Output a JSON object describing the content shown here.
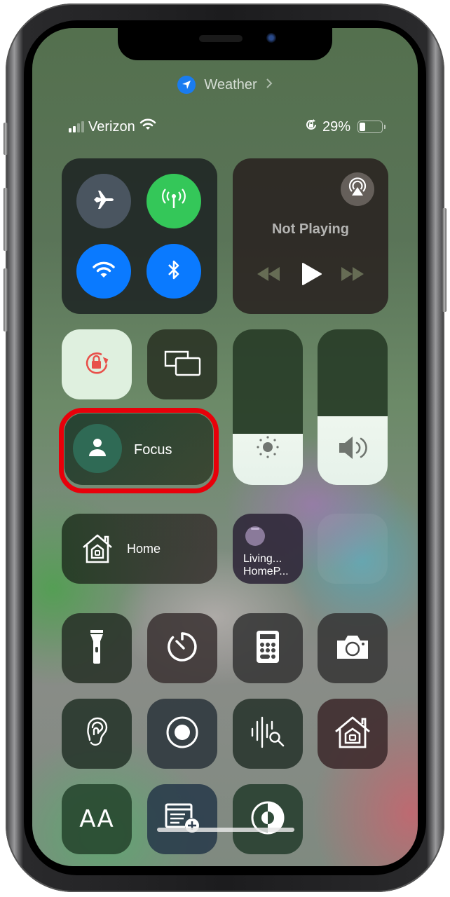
{
  "location_banner": {
    "icon": "location-arrow-icon",
    "app": "Weather",
    "chevron": "chevron-right-icon"
  },
  "status_bar": {
    "carrier": "Verizon",
    "signal_bars_active": 2,
    "signal_bars_total": 4,
    "wifi": "wifi-icon",
    "orientation_lock": "orientation-lock-icon",
    "battery_percent": "29%",
    "battery_level": 0.29
  },
  "connectivity": {
    "airplane": {
      "icon": "airplane-icon",
      "state": "off",
      "color": "#4a5560"
    },
    "cellular": {
      "icon": "cellular-antenna-icon",
      "state": "on",
      "color": "#34c759"
    },
    "wifi": {
      "icon": "wifi-icon",
      "state": "on",
      "color": "#0a7aff"
    },
    "bluetooth": {
      "icon": "bluetooth-icon",
      "state": "on",
      "color": "#0a7aff"
    }
  },
  "now_playing": {
    "title": "Not Playing",
    "airplay": "airplay-audio-icon",
    "rewind": "rewind-icon",
    "play": "play-icon",
    "forward": "fast-forward-icon"
  },
  "orientation_lock": {
    "icon": "orientation-lock-icon",
    "state": "on",
    "accent": "#e8504a"
  },
  "screen_mirroring": {
    "icon": "screen-mirroring-icon"
  },
  "focus": {
    "label": "Focus",
    "icon": "person-icon",
    "highlight_color": "#e8000a"
  },
  "brightness": {
    "icon": "sun-icon",
    "level_percent": 33
  },
  "volume": {
    "icon": "speaker-icon",
    "level_percent": 44
  },
  "home": {
    "label": "Home",
    "icon": "home-icon"
  },
  "homepod": {
    "line1": "Living...",
    "line2": "HomeP...",
    "icon": "homepod-mini-icon"
  },
  "tiles_row1": [
    {
      "name": "flashlight",
      "icon": "flashlight-icon"
    },
    {
      "name": "timer",
      "icon": "timer-icon"
    },
    {
      "name": "calculator",
      "icon": "calculator-icon"
    },
    {
      "name": "camera",
      "icon": "camera-icon"
    }
  ],
  "tiles_row2": [
    {
      "name": "hearing",
      "icon": "ear-icon"
    },
    {
      "name": "screen-recording",
      "icon": "record-icon"
    },
    {
      "name": "sound-recognition",
      "icon": "sound-recognition-icon"
    },
    {
      "name": "home-app",
      "icon": "home-icon"
    }
  ],
  "tiles_row3": [
    {
      "name": "text-size",
      "icon": "text-size-icon",
      "text": "AA"
    },
    {
      "name": "quick-note",
      "icon": "quick-note-icon"
    },
    {
      "name": "dark-mode",
      "icon": "dark-mode-icon"
    }
  ]
}
